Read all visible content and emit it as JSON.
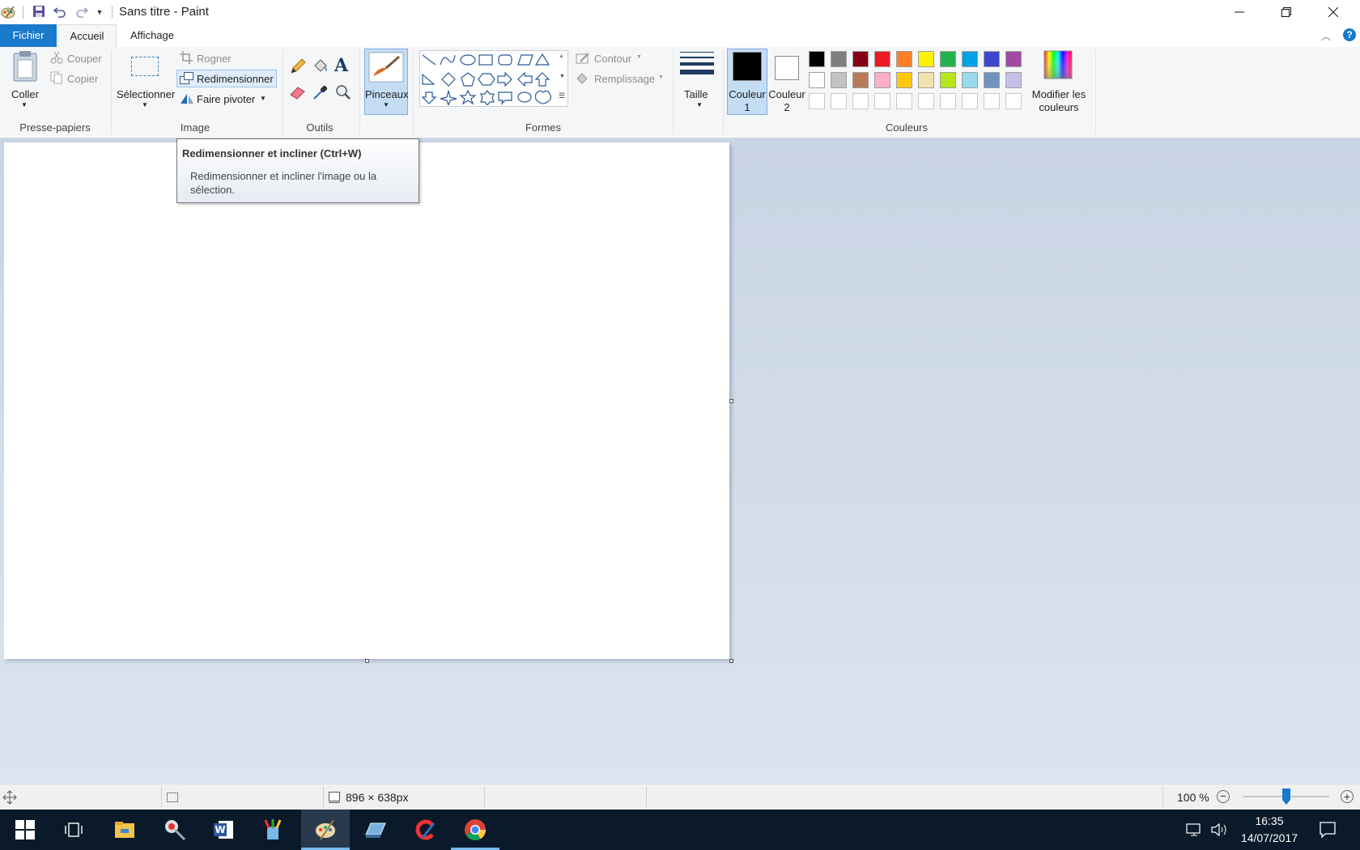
{
  "window": {
    "title": "Sans titre - Paint",
    "controls": [
      "minimize",
      "restore",
      "close"
    ]
  },
  "tabs": {
    "file": "Fichier",
    "home": "Accueil",
    "view": "Affichage"
  },
  "ribbon": {
    "clipboard": {
      "group": "Presse-papiers",
      "paste": "Coller",
      "cut": "Couper",
      "copy": "Copier"
    },
    "image": {
      "group": "Image",
      "select": "Sélectionner",
      "crop": "Rogner",
      "resize": "Redimensionner",
      "rotate": "Faire pivoter"
    },
    "tools": {
      "group": "Outils"
    },
    "brushes": {
      "label": "Pinceaux"
    },
    "shapes": {
      "group": "Formes",
      "outline": "Contour",
      "fill": "Remplissage"
    },
    "size": {
      "label": "Taille"
    },
    "colors": {
      "group": "Couleurs",
      "color1_line1": "Couleur",
      "color1_line2": "1",
      "color2_line1": "Couleur",
      "color2_line2": "2",
      "edit_line1": "Modifier les",
      "edit_line2": "couleurs",
      "color1": "#000000",
      "color2": "#ffffff",
      "palette_row1": [
        "#000000",
        "#7f7f7f",
        "#880015",
        "#ed1c24",
        "#ff7f27",
        "#fff200",
        "#22b14c",
        "#00a2e8",
        "#3f48cc",
        "#a349a4"
      ],
      "palette_row2": [
        "#ffffff",
        "#c3c3c3",
        "#b97a57",
        "#ffaec9",
        "#ffc90e",
        "#efe4b0",
        "#b5e61d",
        "#99d9ea",
        "#7092be",
        "#c8bfe7"
      ]
    }
  },
  "tooltip": {
    "title": "Redimensionner et incliner (Ctrl+W)",
    "body_line1": "Redimensionner et incliner l'image ou la",
    "body_line2": "sélection."
  },
  "status": {
    "canvas_size": "896 × 638px",
    "zoom": "100 %",
    "zoom_slider_fraction": 0.5
  },
  "taskbar": {
    "time": "16:35",
    "date": "14/07/2017"
  }
}
